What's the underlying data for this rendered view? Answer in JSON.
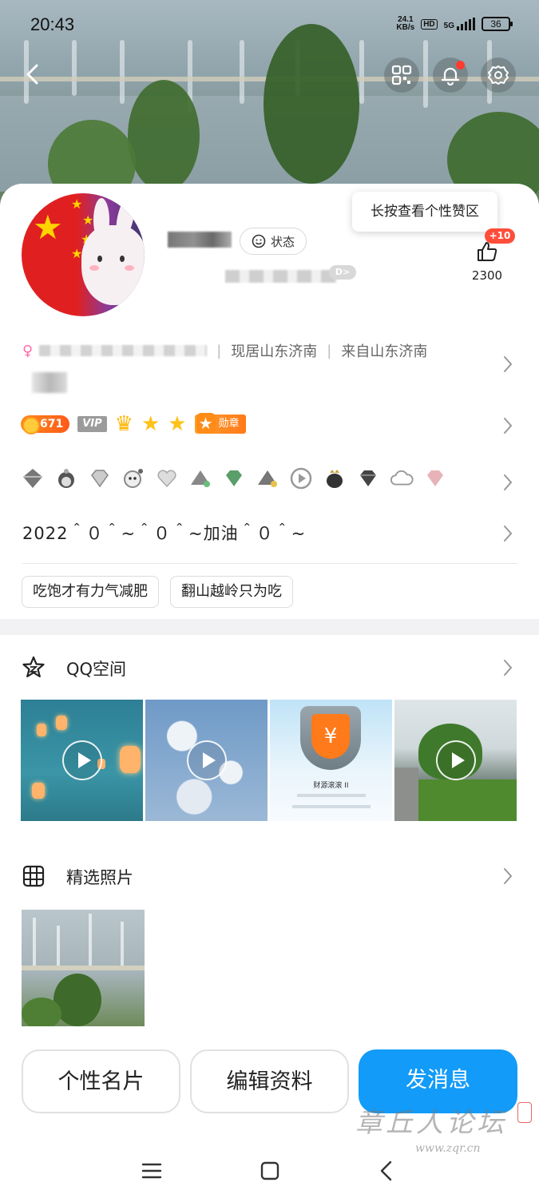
{
  "status_bar": {
    "time": "20:43",
    "network_speed_top": "24.1",
    "network_speed_bottom": "KB/s",
    "hd": "HD",
    "signal_type": "5G",
    "battery": "36"
  },
  "tooltip": {
    "text": "长按查看个性赞区"
  },
  "likes": {
    "badge": "+10",
    "count": "2300"
  },
  "profile": {
    "status_button": "状态"
  },
  "info": {
    "residence": "现居山东济南",
    "hometown": "来自山东济南"
  },
  "badges": {
    "coin_count": "671",
    "vip": "VIP",
    "medal": "勋章"
  },
  "signature": "2022＾０＾~＾０＾~加油＾０＾~",
  "tags": [
    {
      "label": "吃饱才有力气减肥"
    },
    {
      "label": "翻山越岭只为吃"
    }
  ],
  "sections": {
    "qzone": {
      "title": "QQ空间"
    },
    "photos": {
      "title": "精选照片"
    }
  },
  "qzone_thumb3": {
    "title": "财源滚滚 II"
  },
  "buttons": {
    "profile_card": "个性名片",
    "edit_profile": "编辑资料",
    "send_message": "发消息"
  },
  "watermark": {
    "text": "章丘人论坛",
    "url": "www.zqr.cn"
  },
  "colors": {
    "primary": "#129bf8",
    "badge_red": "#ff4d3a",
    "coin_orange": "#ff7a1a"
  }
}
